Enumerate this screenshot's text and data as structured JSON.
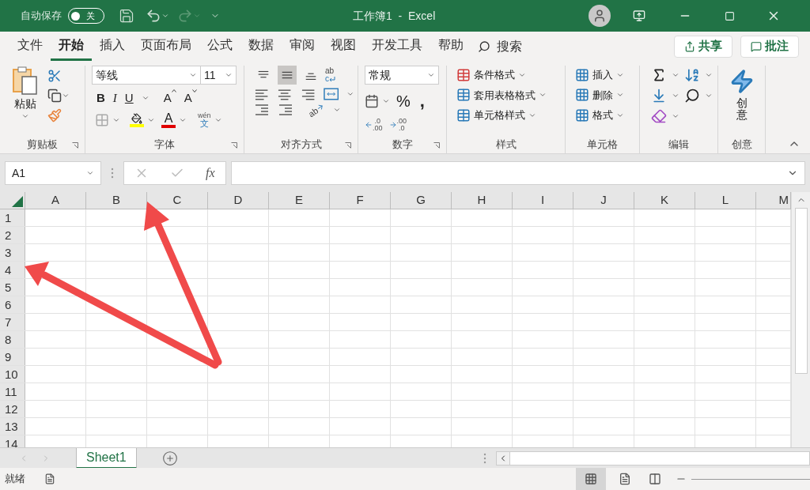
{
  "title_bar": {
    "autosave_label": "自动保存",
    "autosave_state": "关",
    "autosave_on": false,
    "title": "工作簿1  -  Excel"
  },
  "tabs": [
    {
      "label": "文件",
      "selected": false
    },
    {
      "label": "开始",
      "selected": true
    },
    {
      "label": "插入",
      "selected": false
    },
    {
      "label": "页面布局",
      "selected": false
    },
    {
      "label": "公式",
      "selected": false
    },
    {
      "label": "数据",
      "selected": false
    },
    {
      "label": "审阅",
      "selected": false
    },
    {
      "label": "视图",
      "selected": false
    },
    {
      "label": "开发工具",
      "selected": false
    },
    {
      "label": "帮助",
      "selected": false
    }
  ],
  "search": {
    "label": "搜索"
  },
  "share_button": "共享",
  "comments_button": "批注",
  "clipboard": {
    "paste": "粘贴",
    "group_label": "剪贴板"
  },
  "font": {
    "name": "等线",
    "size": "11",
    "bold": "B",
    "italic": "I",
    "underline": "U",
    "grow": "A",
    "shrink": "A",
    "font_color": "A",
    "phonetic_top": "wén",
    "phonetic_bottom": "文",
    "group_label": "字体"
  },
  "alignment": {
    "vertical": [
      {
        "kind": "top",
        "selected": false
      },
      {
        "kind": "middle",
        "selected": true
      },
      {
        "kind": "bottom",
        "selected": false
      }
    ],
    "wrap_top": "ab",
    "wrap_bottom": "c",
    "orientation": "ab",
    "group_label": "对齐方式"
  },
  "number": {
    "format": "常规",
    "percent": "%",
    "comma": ",",
    "increase_decimal": [
      ".0",
      ".00"
    ],
    "decrease_decimal": [
      ".00",
      ".0"
    ],
    "group_label": "数字"
  },
  "styles": {
    "items": [
      "条件格式",
      "套用表格格式",
      "单元格样式"
    ],
    "group_label": "样式"
  },
  "cells": {
    "items": [
      "插入",
      "删除",
      "格式"
    ],
    "group_label": "单元格"
  },
  "editing": {
    "group_label": "编辑"
  },
  "ideas": {
    "label": "创意",
    "group_label": "创意"
  },
  "formula_bar": {
    "name_box": "A1",
    "fx": "fx"
  },
  "columns": [
    "A",
    "B",
    "C",
    "D",
    "E",
    "F",
    "G",
    "H",
    "I",
    "J",
    "K",
    "L",
    "M"
  ],
  "rows": [
    "1",
    "2",
    "3",
    "4",
    "5",
    "6",
    "7",
    "8",
    "9",
    "10",
    "11",
    "12",
    "13",
    "14"
  ],
  "sheet_tabs": [
    {
      "label": "Sheet1",
      "selected": true
    }
  ],
  "status_bar": {
    "status": "就绪"
  }
}
